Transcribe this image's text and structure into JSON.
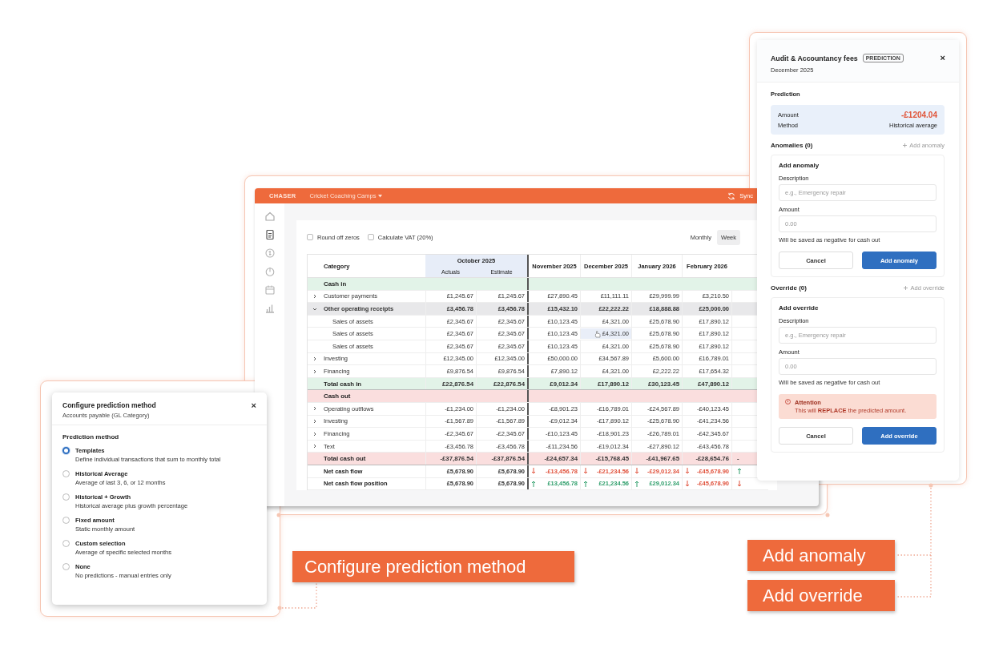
{
  "app": {
    "brand": "CHASER",
    "workspace": "Cricket Coaching Camps",
    "sync": "Sync",
    "nav": [
      {
        "kind": "home",
        "selected": false
      },
      {
        "kind": "document",
        "selected": true
      },
      {
        "kind": "coin",
        "selected": false
      },
      {
        "kind": "clock",
        "selected": false
      },
      {
        "kind": "calendar",
        "selected": false
      },
      {
        "kind": "chart",
        "selected": false
      }
    ],
    "options": [
      {
        "label": "Round off zeros",
        "checked": false
      },
      {
        "label": "Calculate VAT (20%)",
        "checked": false
      }
    ],
    "views": [
      {
        "label": "Monthly",
        "selected": false
      },
      {
        "label": "Week",
        "selected": true
      }
    ],
    "table": {
      "columns": [
        {
          "label": "Category"
        },
        {
          "label": "October 2025",
          "subcolumns": [
            "Actuals",
            "Estimate"
          ]
        },
        {
          "label": "November 2025"
        },
        {
          "label": "December 2025"
        },
        {
          "label": "January 2026"
        },
        {
          "label": "February 2026"
        }
      ],
      "rows": [
        {
          "kind": "section",
          "color": "#e2f3e8",
          "label": "Cash in"
        },
        {
          "kind": "item",
          "label": "Customer payments",
          "expanded": false,
          "cells": [
            "£1,245.67",
            "£1,245.67",
            "£27,890.45",
            "£11,111.11",
            "£29,999.99",
            "£3,210.50"
          ]
        },
        {
          "kind": "item",
          "label": "Other operating receipts",
          "expanded": true,
          "cells": [
            "£3,456.78",
            "£3,456.78",
            "£15,432.10",
            "£22,222.22",
            "£18,888.88",
            "£25,000.00"
          ]
        },
        {
          "kind": "child",
          "label": "Sales of assets",
          "cells": [
            "£2,345.67",
            "£2,345.67",
            "£10,123.45",
            "£4,321.00",
            "£25,678.90",
            "£17,890.12"
          ]
        },
        {
          "kind": "child",
          "label": "Sales of assets",
          "cells": [
            "£2,345.67",
            "£2,345.67",
            "£10,123.45",
            {
              "text": "£4,321.00",
              "hovered": true
            },
            "£25,678.90",
            "£17,890.12"
          ]
        },
        {
          "kind": "child",
          "label": "Sales of assets",
          "cells": [
            "£2,345.67",
            "£2,345.67",
            "£10,123.45",
            "£4,321.00",
            "£25,678.90",
            "£17,890.12"
          ]
        },
        {
          "kind": "item",
          "label": "Investing",
          "expanded": false,
          "cells": [
            "£12,345.00",
            "£12,345.00",
            "£50,000.00",
            "£34,567.89",
            "£5,600.00",
            "£16,789.01"
          ]
        },
        {
          "kind": "item",
          "label": "Financing",
          "expanded": false,
          "cells": [
            "£9,876.54",
            "£9,876.54",
            "£7,890.12",
            "£4,321.00",
            "£2,222.22",
            "£17,654.32"
          ]
        },
        {
          "kind": "total",
          "color": "#e2f3e8",
          "label": "Total cash in",
          "cells": [
            "£22,876.54",
            "£22,876.54",
            "£9,012.34",
            "£17,890.12",
            "£30,123.45",
            "£47,890.12"
          ]
        },
        {
          "kind": "section",
          "color": "#fadede",
          "label": "Cash out"
        },
        {
          "kind": "item",
          "label": "Operating outflows",
          "expanded": false,
          "cells": [
            "-£1,234.00",
            "-£1,234.00",
            "-£8,901.23",
            "-£16,789.01",
            "-£24,567.89",
            "-£40,123.45"
          ]
        },
        {
          "kind": "item",
          "label": "Investing",
          "expanded": false,
          "cells": [
            "-£1,567.89",
            "-£1,567.89",
            "-£9,012.34",
            "-£17,890.12",
            "-£25,678.90",
            "-£41,234.56"
          ]
        },
        {
          "kind": "item",
          "label": "Financing",
          "expanded": false,
          "cells": [
            "-£2,345.67",
            "-£2,345.67",
            "-£10,123.45",
            "-£18,901.23",
            "-£26,789.01",
            "-£42,345.67"
          ]
        },
        {
          "kind": "item",
          "label": "Text",
          "expanded": false,
          "cells": [
            "-£3,456.78",
            "-£3,456.78",
            "-£11,234.56",
            "-£19,012.34",
            "-£27,890.12",
            "-£43,456.78"
          ]
        },
        {
          "kind": "total",
          "color": "#fadede",
          "label": "Total cash out",
          "cells": [
            "-£37,876.54",
            "-£37,876.54",
            "-£24,657.34",
            "-£15,768.45",
            "-£41,967.65",
            "-£28,654.76"
          ],
          "cut_cell": {
            "text": "-"
          }
        },
        {
          "kind": "net",
          "label": "Net cash flow",
          "cells": [
            "£5,678.90",
            "£5,678.90",
            {
              "text": "-£13,456.78",
              "up": false
            },
            {
              "text": "-£21,234.56",
              "up": false
            },
            {
              "text": "-£29,012.34",
              "up": false
            },
            {
              "text": "-£45,678.90",
              "up": false
            }
          ],
          "cut_cell": {
            "up": true
          }
        },
        {
          "kind": "net",
          "label": "Net cash flow position",
          "cells": [
            "£5,678.90",
            "£5,678.90",
            {
              "text": "£13,456.78",
              "up": true
            },
            {
              "text": "£21,234.56",
              "up": true
            },
            {
              "text": "£29,012.34",
              "up": true
            },
            {
              "text": "-£45,678.90",
              "up": false
            }
          ],
          "cut_cell": {
            "up": false
          }
        }
      ]
    }
  },
  "configure_panel": {
    "title": "Configure prediction method",
    "subtitle": "Accounts payable (GL Category)",
    "close": "×",
    "heading": "Prediction method",
    "methods": [
      {
        "label": "Templates",
        "description": "Define individual transactions that sum to monthly total",
        "selected": true
      },
      {
        "label": "Historical Average",
        "description": "Average of last 3, 6, or 12 months",
        "selected": false
      },
      {
        "label": "Historical + Growth",
        "description": "Historical average plus growth percentage",
        "selected": false
      },
      {
        "label": "Fixed amount",
        "description": "Static monthly amount",
        "selected": false
      },
      {
        "label": "Custom selection",
        "description": "Average of specific selected months",
        "selected": false
      },
      {
        "label": "None",
        "description": "No predictions - manual entries only",
        "selected": false
      }
    ]
  },
  "detail_panel": {
    "title": "Audit & Accountancy fees",
    "badge": "PREDICTION",
    "close": "×",
    "subtitle": "December 2025",
    "prediction": {
      "heading": "Prediction",
      "rows": [
        {
          "label": "Amount",
          "value": "-£1204.04",
          "kind": "amount"
        },
        {
          "label": "Method",
          "value": "Historical average",
          "kind": "text"
        }
      ]
    },
    "sections": [
      {
        "heading": "Anomalies (0)",
        "action": {
          "label": "Add anomaly",
          "disabled": true
        },
        "form": {
          "title": "Add anomaly",
          "fields": [
            {
              "label": "Description",
              "placeholder": "e.g., Emergency repair"
            },
            {
              "label": "Amount",
              "placeholder": "0.00"
            }
          ],
          "hint": "Will be saved as negative for cash out",
          "buttons": [
            {
              "label": "Cancel",
              "kind": "secondary"
            },
            {
              "label": "Add anomaly",
              "kind": "primary"
            }
          ]
        }
      },
      {
        "heading": "Override (0)",
        "action": {
          "label": "Add override",
          "disabled": true
        },
        "form": {
          "title": "Add override",
          "fields": [
            {
              "label": "Description",
              "placeholder": "e.g., Emergency repair"
            },
            {
              "label": "Amount",
              "placeholder": "0.00"
            }
          ],
          "hint": "Will be saved as negative for cash out",
          "alert": {
            "title": "Attention",
            "text": "This will **REPLACE** the predicted amount."
          },
          "buttons": [
            {
              "label": "Cancel",
              "kind": "secondary"
            },
            {
              "label": "Add override",
              "kind": "primary"
            }
          ]
        }
      }
    ]
  },
  "callouts": [
    {
      "label": "Configure prediction method"
    },
    {
      "label": "Add anomaly"
    },
    {
      "label": "Add override"
    }
  ]
}
